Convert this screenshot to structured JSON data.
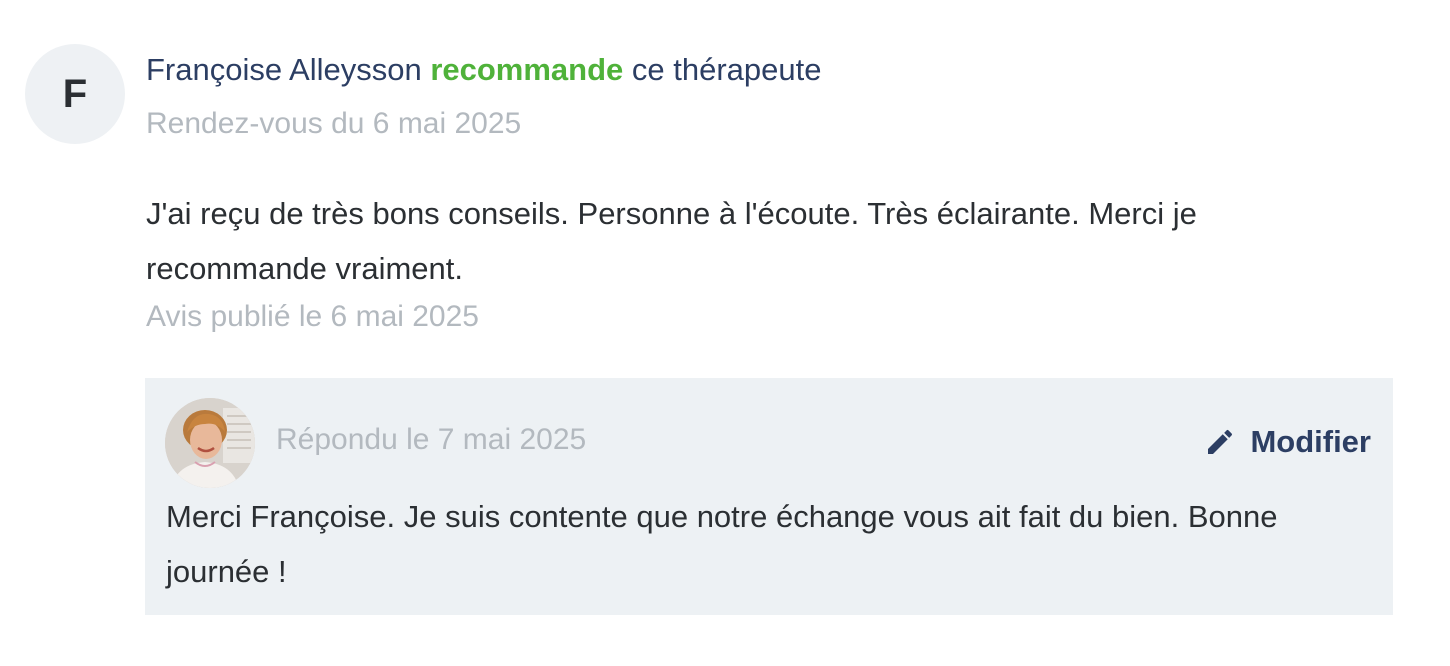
{
  "review": {
    "avatar_letter": "F",
    "author": "Françoise Alleysson",
    "verb": "recommande",
    "object": "ce thérapeute",
    "appointment_date": "Rendez-vous du 6 mai 2025",
    "text": "J'ai reçu de très bons conseils. Personne à l'écoute. Très éclairante. Merci je recommande vraiment.",
    "published": "Avis publié le 6 mai 2025"
  },
  "reply": {
    "date": "Répondu le 7 mai 2025",
    "edit_label": "Modifier",
    "edit_icon": "pencil-icon",
    "text": "Merci Françoise. Je suis contente que notre échange vous ait fait du bien. Bonne journée !"
  },
  "colors": {
    "author_text": "#2c3e63",
    "recommend_green": "#4fb23a",
    "muted_text": "#b3b9bf",
    "reply_background": "#edf1f4",
    "avatar_background": "#eef1f4"
  }
}
